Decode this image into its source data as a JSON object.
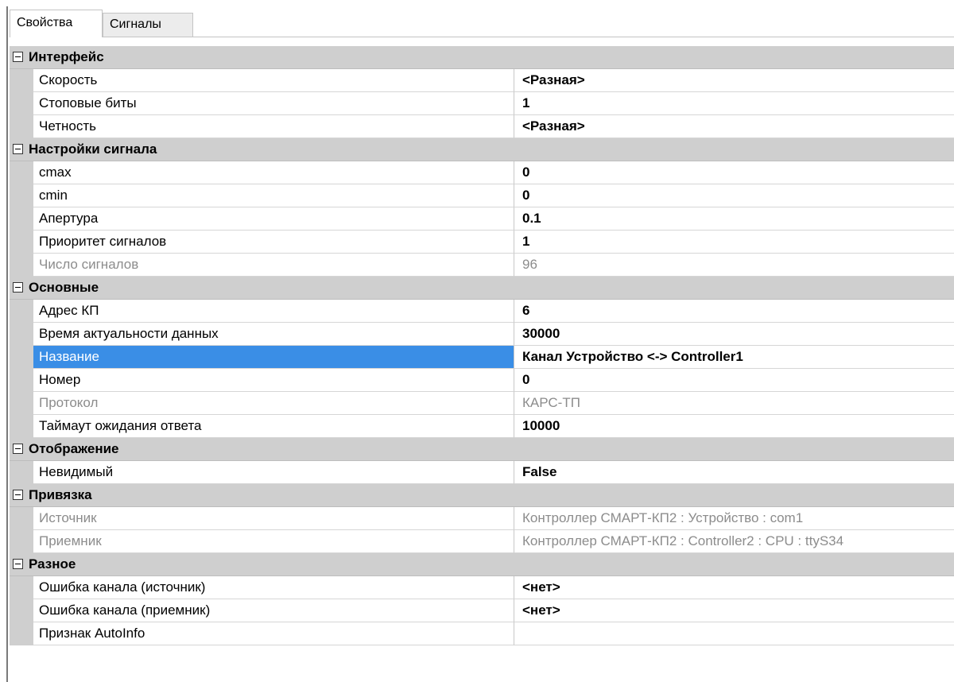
{
  "tabs": [
    {
      "label": "Свойства"
    },
    {
      "label": "Сигналы"
    }
  ],
  "groups": [
    {
      "label": "Интерфейс",
      "props": [
        {
          "name": "Скорость",
          "value": "<Разная>"
        },
        {
          "name": "Стоповые биты",
          "value": "1"
        },
        {
          "name": "Четность",
          "value": "<Разная>"
        }
      ]
    },
    {
      "label": "Настройки сигнала",
      "props": [
        {
          "name": "cmax",
          "value": "0"
        },
        {
          "name": "cmin",
          "value": "0"
        },
        {
          "name": "Апертура",
          "value": "0.1"
        },
        {
          "name": "Приоритет сигналов",
          "value": "1"
        },
        {
          "name": "Число сигналов",
          "value": "96"
        }
      ]
    },
    {
      "label": "Основные",
      "props": [
        {
          "name": "Адрес КП",
          "value": "6"
        },
        {
          "name": "Время актуальности данных",
          "value": "30000"
        },
        {
          "name": "Название",
          "value": "Канал Устройство <-> Controller1"
        },
        {
          "name": "Номер",
          "value": "0"
        },
        {
          "name": "Протокол",
          "value": "КАРС-ТП"
        },
        {
          "name": "Таймаут ожидания ответа",
          "value": "10000"
        }
      ]
    },
    {
      "label": "Отображение",
      "props": [
        {
          "name": "Невидимый",
          "value": "False"
        }
      ]
    },
    {
      "label": "Привязка",
      "props": [
        {
          "name": "Источник",
          "value": "Контроллер СМАРТ-КП2 : Устройство : com1"
        },
        {
          "name": "Приемник",
          "value": "Контроллер СМАРТ-КП2 : Controller2 : CPU : ttyS34"
        }
      ]
    },
    {
      "label": "Разное",
      "props": [
        {
          "name": "Ошибка канала (источник)",
          "value": "<нет>"
        },
        {
          "name": "Ошибка канала (приемник)",
          "value": "<нет>"
        },
        {
          "name": "Признак AutoInfo",
          "value": ""
        }
      ]
    }
  ]
}
